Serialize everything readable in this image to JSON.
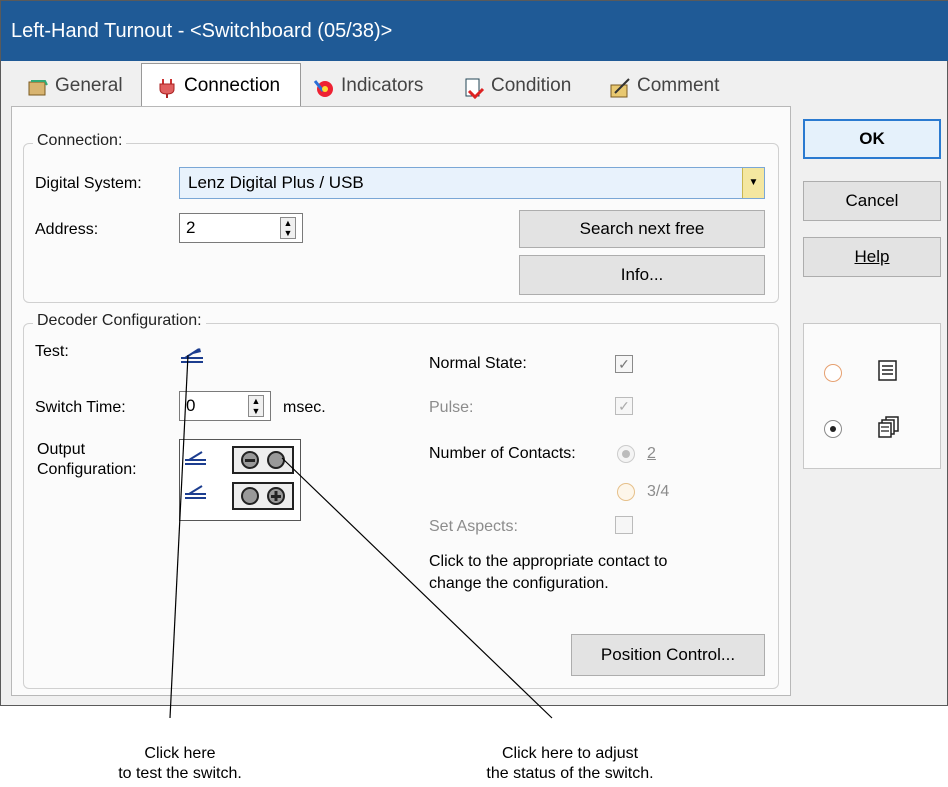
{
  "window": {
    "title": "Left-Hand Turnout - <Switchboard (05/38)>"
  },
  "tabs": [
    {
      "label": "General"
    },
    {
      "label": "Connection"
    },
    {
      "label": "Indicators"
    },
    {
      "label": "Condition"
    },
    {
      "label": "Comment"
    }
  ],
  "connection": {
    "title": "Connection:",
    "digital_system_label": "Digital System:",
    "digital_system_value": "Lenz Digital Plus / USB",
    "address_label": "Address:",
    "address_value": "2",
    "search_button": "Search next free",
    "info_button": "Info..."
  },
  "decoder": {
    "title": "Decoder Configuration:",
    "test_label": "Test:",
    "switch_time_label": "Switch Time:",
    "switch_time_value": "0",
    "switch_time_unit": "msec.",
    "output_label_1": "Output",
    "output_label_2": "Configuration:",
    "normal_state_label": "Normal State:",
    "pulse_label": "Pulse:",
    "contacts_label": "Number of Contacts:",
    "contacts_option_1": "2",
    "contacts_option_2": "3/4",
    "set_aspects_label": "Set Aspects:",
    "hint_1": "Click to the appropriate contact to",
    "hint_2": "change the configuration.",
    "position_button": "Position Control..."
  },
  "side_buttons": {
    "ok": "OK",
    "cancel": "Cancel",
    "help": "Help"
  },
  "annotations": {
    "left_1": "Click here",
    "left_2": "to test  the switch.",
    "right_1": "Click here to adjust",
    "right_2": "the status of the switch."
  },
  "colors": {
    "titlebar": "#1f5a96",
    "selected_field": "#e8f2fc"
  }
}
